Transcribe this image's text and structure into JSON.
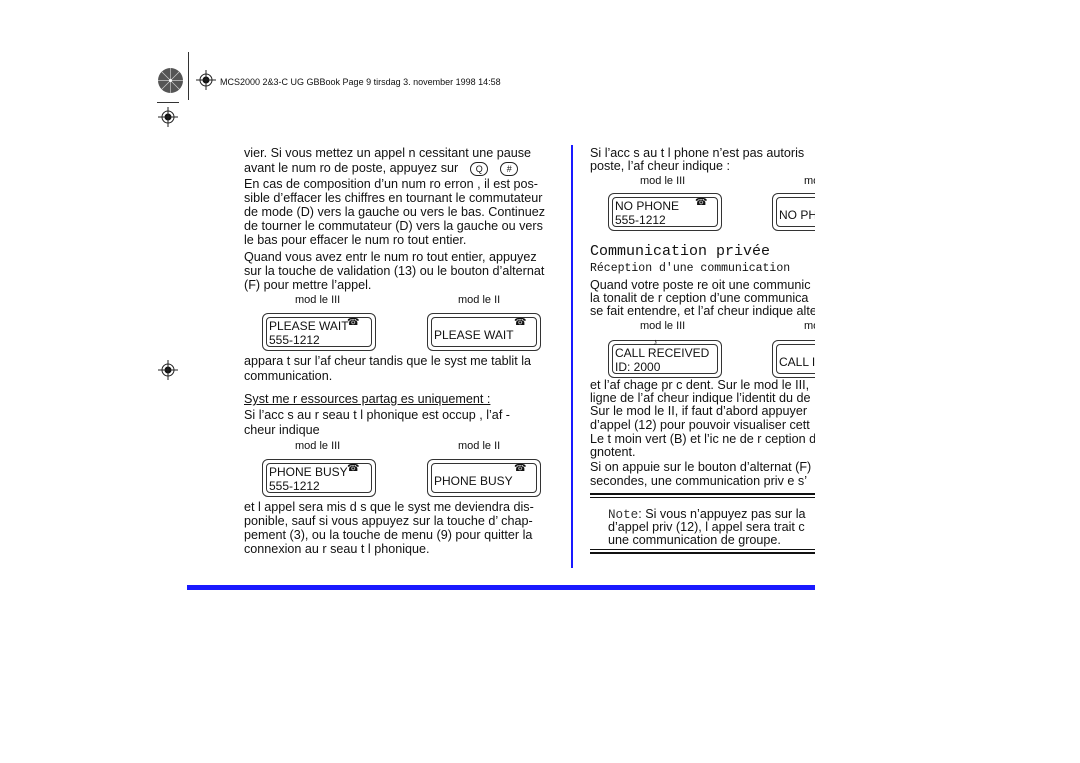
{
  "header": {
    "text": "MCS2000 2&3-C UG GBBook  Page 9  tirsdag 3. november 1998  14:58"
  },
  "colors": {
    "accent": "#1a1aff"
  },
  "left": {
    "p1": [
      "vier. Si vous  mettez un appel n cessitant une pause",
      "avant le num ro de poste, appuyez sur"
    ],
    "keys": [
      "Q",
      "#"
    ],
    "p2": [
      "En cas de composition d’un num ro erron , il est pos-",
      "sible d’effacer les chiffres en tournant le commutateur",
      "de mode (D) vers la gauche ou vers le bas. Continuez",
      "de tourner le commutateur (D) vers la gauche ou vers",
      "le bas pour effacer le num ro tout entier."
    ],
    "p3": [
      "Quand vous avez entr  le num ro tout entier, appuyez",
      "sur la touche de validation (13) ou le bouton d’alternat",
      "(F) pour  mettre l’appel."
    ],
    "label3": "mod le III",
    "label2": "mod le II",
    "wait3": [
      "PLEASE WAIT",
      "555-1212"
    ],
    "wait2": "PLEASE WAIT",
    "p4": [
      "appara t sur l’af cheur tandis que le syst me  tablit la",
      "communication."
    ],
    "subhead": "Syst me   r  essources partag es uniquement :",
    "p5": [
      "Si l’acc s au r seau t l phonique est occup , l’af -",
      "cheur indique"
    ],
    "busy3": [
      "PHONE BUSY",
      "555-1212"
    ],
    "busy2": "PHONE BUSY",
    "p6": [
      "et l appel sera  mis d s que le syst me deviendra dis-",
      "ponible, sauf si vous appuyez sur la touche d’ chap-",
      "pement (3), ou la touche de menu (9) pour quitter la",
      "connexion au r seau t l phonique."
    ]
  },
  "right": {
    "p1": [
      "Si l’acc s au t l phone n’est pas autoris",
      "poste, l’af cheur indique :"
    ],
    "label3": "mod le III",
    "label2": "mo",
    "nophone3": [
      "NO PHONE",
      "555-1212"
    ],
    "nophone2": "NO PH",
    "heading": "Communication privée",
    "subheading": "Réception d'une communication",
    "p2": [
      "Quand votre poste re oit une communic",
      "la tonalit  de r ception d’une communica",
      "se fait entendre, et l’af cheur indique alte"
    ],
    "call3": [
      "CALL RECEIVED",
      "ID: 2000"
    ],
    "call2": "CALL I",
    "p3": [
      "et l’af chage pr c dent. Sur le mod le III,",
      "ligne de l’af cheur indique l’identit  du de",
      "Sur le mod le II, if faut d’abord appuyer",
      "d’appel (12) pour pouvoir visualiser cett"
    ],
    "p4": [
      "Le t moin vert (B) et l’ic ne de r ception d",
      "gnotent."
    ],
    "p5": [
      "Si on appuie sur le bouton d’alternat (F)",
      "secondes, une communication priv e s’"
    ],
    "note_label": "Note",
    "note": [
      ": Si vous n’appuyez pas sur la",
      "d’appel priv  (12), l appel sera trait  c",
      "une communication de groupe."
    ]
  }
}
